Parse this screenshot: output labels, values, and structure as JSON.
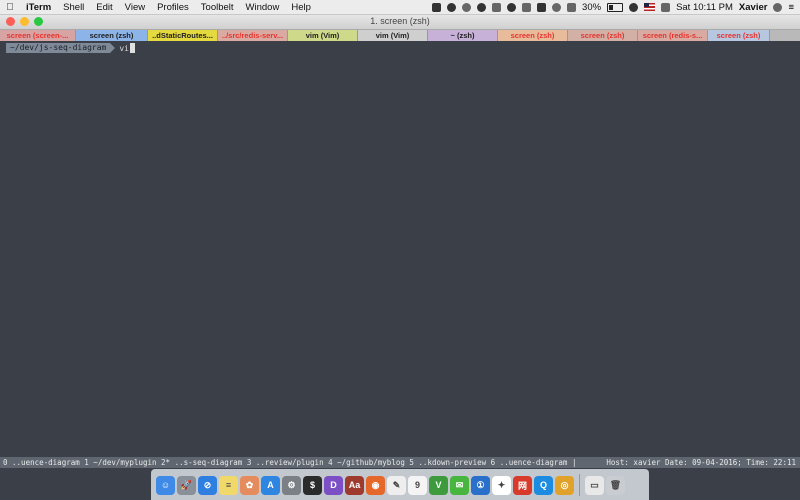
{
  "menubar": {
    "apple": "",
    "items": [
      "iTerm",
      "Shell",
      "Edit",
      "View",
      "Profiles",
      "Toolbelt",
      "Window",
      "Help"
    ],
    "battery": "30%",
    "clock": "Sat 10:11 PM",
    "user": "Xavier"
  },
  "window": {
    "title": "1. screen (zsh)"
  },
  "tabs": [
    {
      "label": "screen (screen-...",
      "bg": "#d7a3a3",
      "fg": "#e8322d"
    },
    {
      "label": "screen (zsh)",
      "bg": "#8db4e8",
      "fg": "#1d1d1d"
    },
    {
      "label": "..dStaticRoutes...",
      "bg": "#e4d93e",
      "fg": "#1d1d1d"
    },
    {
      "label": "../src/redis-serv...",
      "bg": "#d9aaa2",
      "fg": "#e8322d"
    },
    {
      "label": "vim (Vim)",
      "bg": "#cfd98a",
      "fg": "#1d1d1d"
    },
    {
      "label": "vim (Vim)",
      "bg": "#cfcfcf",
      "fg": "#1d1d1d"
    },
    {
      "label": "~ (zsh)",
      "bg": "#c8b1d8",
      "fg": "#1d1d1d"
    },
    {
      "label": "screen (zsh)",
      "bg": "#e8bb9a",
      "fg": "#e8322d"
    },
    {
      "label": "screen (zsh)",
      "bg": "#d3b0a6",
      "fg": "#e8322d"
    },
    {
      "label": "screen (redis-s...",
      "bg": "#d9aaa2",
      "fg": "#e8322d"
    },
    {
      "label": "screen (zsh)",
      "bg": "#b7c7e0",
      "fg": "#e8322d"
    }
  ],
  "terminal": {
    "prompt_path": "~/dev/js-seq-diagram",
    "command": "vi"
  },
  "statusbar": {
    "windows": "0 ..uence-diagram  1 ~/dev/myplugin  2* ..s-seq-diagram  3 ..review/plugin  4 ~/github/myblog  5 ..kdown-preview  6 ..uence-diagram |",
    "info": "Host: xavier Date: 09-04-2016; Time: 22:11"
  },
  "dock": {
    "apps": [
      {
        "name": "finder",
        "glyph": "☺",
        "color": "#3f8ae6"
      },
      {
        "name": "launchpad",
        "glyph": "🚀",
        "color": "#8a9099"
      },
      {
        "name": "safari",
        "glyph": "⊘",
        "color": "#2e7fe0"
      },
      {
        "name": "notes",
        "glyph": "≡",
        "color": "#f1d86a"
      },
      {
        "name": "photos",
        "glyph": "✿",
        "color": "#e58c5f"
      },
      {
        "name": "app-store",
        "glyph": "A",
        "color": "#2f86e0"
      },
      {
        "name": "system-preferences",
        "glyph": "⚙",
        "color": "#7b7f86"
      },
      {
        "name": "iterm",
        "glyph": "$",
        "color": "#2b2b2b"
      },
      {
        "name": "dash",
        "glyph": "D",
        "color": "#7d4fc5"
      },
      {
        "name": "dictionary",
        "glyph": "Aa",
        "color": "#9e3b2e"
      },
      {
        "name": "firefox",
        "glyph": "◉",
        "color": "#e5682a"
      },
      {
        "name": "textedit",
        "glyph": "✎",
        "color": "#eeeeee"
      },
      {
        "name": "calendar",
        "glyph": "9",
        "color": "#f4f4f4"
      },
      {
        "name": "vim",
        "glyph": "V",
        "color": "#3d9a3d"
      },
      {
        "name": "wechat",
        "glyph": "✉",
        "color": "#48b53f"
      },
      {
        "name": "onepassword",
        "glyph": "①",
        "color": "#2a6fc9"
      },
      {
        "name": "sticky-bird",
        "glyph": "✦",
        "color": "#ffffff"
      },
      {
        "name": "netease",
        "glyph": "网",
        "color": "#d83a2b"
      },
      {
        "name": "qq",
        "glyph": "Q",
        "color": "#1d8ce0"
      },
      {
        "name": "chrome",
        "glyph": "◎",
        "color": "#e0a22a"
      }
    ],
    "trash": [
      {
        "name": "downloads",
        "glyph": "▭",
        "color": "#e8e8e8"
      },
      {
        "name": "trash",
        "glyph": "🗑",
        "color": "#c9ccd0"
      }
    ]
  }
}
